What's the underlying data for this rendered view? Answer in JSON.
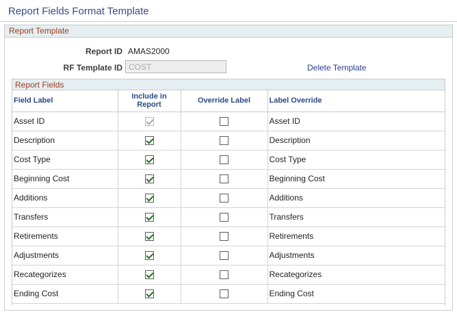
{
  "page": {
    "title": "Report Fields Format Template"
  },
  "report_template": {
    "section_title": "Report Template",
    "report_id_label": "Report ID",
    "report_id_value": "AMAS2000",
    "rf_template_label": "RF Template ID",
    "rf_template_value": "COST",
    "delete_link": "Delete Template"
  },
  "report_fields": {
    "section_title": "Report Fields",
    "columns": {
      "field_label": "Field Label",
      "include": "Include in Report",
      "override": "Override Label",
      "label_override": "Label Override"
    },
    "rows": [
      {
        "field": "Asset ID",
        "include": true,
        "include_disabled": true,
        "override": false,
        "label": "Asset ID"
      },
      {
        "field": "Description",
        "include": true,
        "include_disabled": false,
        "override": false,
        "label": "Description"
      },
      {
        "field": "Cost Type",
        "include": true,
        "include_disabled": false,
        "override": false,
        "label": "Cost Type"
      },
      {
        "field": "Beginning Cost",
        "include": true,
        "include_disabled": false,
        "override": false,
        "label": "Beginning Cost"
      },
      {
        "field": "Additions",
        "include": true,
        "include_disabled": false,
        "override": false,
        "label": "Additions"
      },
      {
        "field": "Transfers",
        "include": true,
        "include_disabled": false,
        "override": false,
        "label": "Transfers"
      },
      {
        "field": "Retirements",
        "include": true,
        "include_disabled": false,
        "override": false,
        "label": "Retirements"
      },
      {
        "field": "Adjustments",
        "include": true,
        "include_disabled": false,
        "override": false,
        "label": "Adjustments"
      },
      {
        "field": "Recategorizes",
        "include": true,
        "include_disabled": false,
        "override": false,
        "label": "Recategorizes"
      },
      {
        "field": "Ending Cost",
        "include": true,
        "include_disabled": false,
        "override": false,
        "label": "Ending Cost"
      }
    ]
  }
}
